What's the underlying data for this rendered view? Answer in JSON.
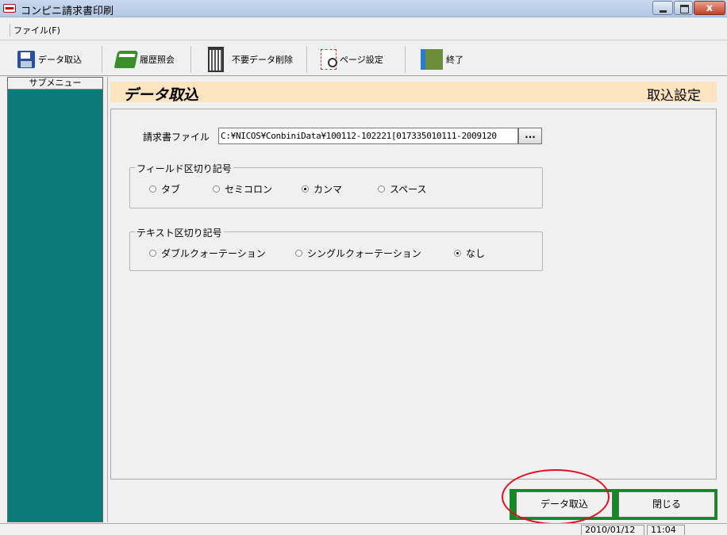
{
  "window": {
    "title": "コンピニ請求書印刷",
    "close_label": "x"
  },
  "menu": {
    "file": "ファイル(F)"
  },
  "toolbar": {
    "import": "データ取込",
    "history": "履歴照会",
    "delete_unneeded": "不要データ削除",
    "page_setup": "ページ設定",
    "exit": "終了"
  },
  "sidebar": {
    "title": "サブメニュー"
  },
  "header": {
    "title": "データ取込",
    "subtitle": "取込設定"
  },
  "form": {
    "file_label": "請求書ファイル",
    "file_value": "C:¥NICOS¥ConbiniData¥100112-102221[017335010111-2009120",
    "browse_label": "...",
    "field_sep": {
      "title": "フィールド区切り記号",
      "options": [
        "タブ",
        "セミコロン",
        "カンマ",
        "スペース"
      ],
      "selected": "カンマ"
    },
    "text_sep": {
      "title": "テキスト区切り記号",
      "options": [
        "ダブルクォーテーション",
        "シングルクォーテーション",
        "なし"
      ],
      "selected": "なし"
    }
  },
  "buttons": {
    "import": "データ取込",
    "close": "閉じる"
  },
  "status": {
    "date": "2010/01/12",
    "time": "11:04"
  },
  "colors": {
    "sidebar": "#0c7a78",
    "header_band": "#fde4c0",
    "button_frame": "#118a24",
    "highlight": "#e01020"
  }
}
